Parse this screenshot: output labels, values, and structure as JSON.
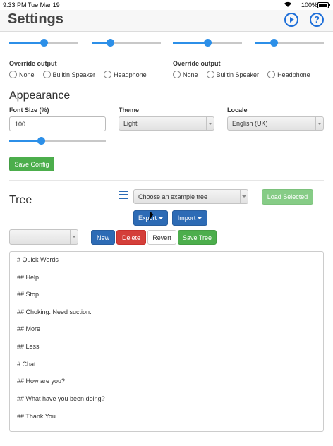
{
  "status_bar": {
    "time": "9:33 PM",
    "date": "Tue Mar 19",
    "battery": "100%"
  },
  "header": {
    "title": "Settings",
    "play_icon": "play-circle-icon",
    "help_icon": "help-circle-icon",
    "help_glyph": "?"
  },
  "sliders": [
    {
      "value": 0.5
    },
    {
      "value": 0.27
    },
    {
      "value": 0.5
    },
    {
      "value": 0.28
    }
  ],
  "override_left": {
    "label": "Override output",
    "options": [
      "None",
      "Builtin Speaker",
      "Headphone"
    ]
  },
  "override_right": {
    "label": "Override output",
    "options": [
      "None",
      "Builtin Speaker",
      "Headphone"
    ]
  },
  "appearance": {
    "heading": "Appearance",
    "font_size_label": "Font Size (%)",
    "font_size_value": "100",
    "font_slider_value": 0.33,
    "theme_label": "Theme",
    "theme_value": "Light",
    "locale_label": "Locale",
    "locale_value": "English (UK)",
    "save_config": "Save Config"
  },
  "tree": {
    "heading": "Tree",
    "menu_icon": "hamburger-menu-icon",
    "example_placeholder": "Choose an example tree",
    "load_selected": "Load Selected",
    "export": "Export",
    "import": "Import",
    "new": "New",
    "delete": "Delete",
    "revert": "Revert",
    "save_tree": "Save Tree",
    "lines": [
      "# Quick Words",
      "## Help",
      "## Stop",
      "## Choking. Need suction.",
      "## More",
      "## Less",
      "# Chat",
      "## How are you?",
      "## What have you been doing?",
      "## Thank You"
    ]
  },
  "colors": {
    "accent": "#2c8fe8",
    "primary": "#2d6bb5",
    "success": "#4cae4c",
    "danger": "#d43f3a"
  }
}
